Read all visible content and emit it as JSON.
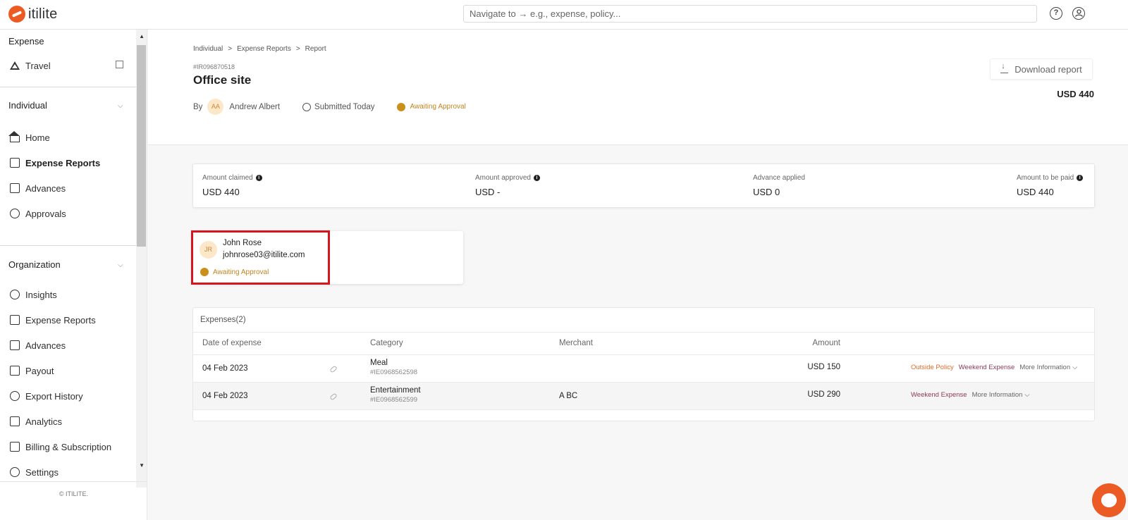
{
  "app": {
    "logo_text": "itilite"
  },
  "topbar": {
    "search_placeholder": "Navigate to → e.g., expense, policy...",
    "help_icon": "?",
    "account_icon": "user"
  },
  "sidebar": {
    "expense_section": "Expense",
    "travel": "Travel",
    "individual_section": "Individual",
    "individual_items": [
      {
        "label": "Home"
      },
      {
        "label": "Expense Reports"
      },
      {
        "label": "Advances"
      },
      {
        "label": "Approvals"
      }
    ],
    "organization_section": "Organization",
    "organization_items": [
      {
        "label": "Insights"
      },
      {
        "label": "Expense Reports"
      },
      {
        "label": "Advances"
      },
      {
        "label": "Payout"
      },
      {
        "label": "Export History"
      },
      {
        "label": "Analytics"
      },
      {
        "label": "Billing & Subscription"
      },
      {
        "label": "Settings"
      }
    ],
    "copyright": "© ITILITE."
  },
  "breadcrumb": {
    "items": [
      "Individual",
      "Expense Reports",
      "Report"
    ],
    "separator": ">"
  },
  "report": {
    "id": "#IR096870518",
    "title": "Office site",
    "by_label": "By",
    "owner_initials": "AA",
    "owner_name": "Andrew Albert",
    "submitted": "Submitted Today",
    "status": "Awaiting Approval",
    "download_label": "Download report",
    "total": "USD 440"
  },
  "summary": {
    "claimed_label": "Amount claimed",
    "claimed_value": "USD 440",
    "approved_label": "Amount approved",
    "approved_value": "USD -",
    "advance_label": "Advance applied",
    "advance_value": "USD 0",
    "to_pay_label": "Amount to be paid",
    "to_pay_value": "USD 440"
  },
  "approver": {
    "initials": "JR",
    "name": "John Rose",
    "email": "johnrose03@itilite.com",
    "status": "Awaiting Approval"
  },
  "expenses": {
    "title": "Expenses(2)",
    "columns": [
      "Date of expense",
      "Category",
      "Merchant",
      "Amount"
    ],
    "rows": [
      {
        "date": "04 Feb 2023",
        "category": "Meal",
        "id": "#IE0968562598",
        "merchant": "",
        "amount": "USD 150",
        "tag1": "Outside Policy",
        "tag2": "Weekend Expense",
        "more": "More Information"
      },
      {
        "date": "04 Feb 2023",
        "category": "Entertainment",
        "id": "#IE0968562599",
        "merchant": "A BC",
        "amount": "USD 290",
        "tag1": "Weekend Expense",
        "more": "More Information"
      }
    ]
  },
  "colors": {
    "brand": "#ec5b24",
    "status": "#c9911c",
    "highlight": "#d8141c"
  }
}
